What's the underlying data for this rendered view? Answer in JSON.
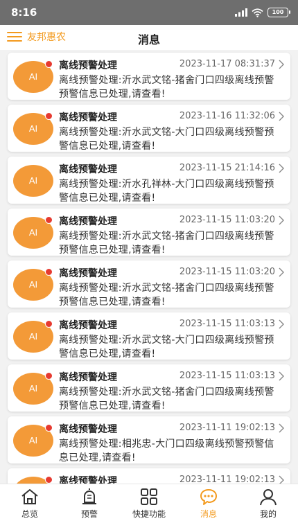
{
  "status_bar": {
    "time": "8:16",
    "battery": "100"
  },
  "header": {
    "brand": "友邦惠农",
    "title": "消息"
  },
  "messages": [
    {
      "avatar": "AI",
      "title": "离线预警处理",
      "time": "2023-11-17 08:31:37",
      "body": "离线预警处理:沂水武文铭-猪舍门口四级离线预警预警信息已处理,请查看!"
    },
    {
      "avatar": "AI",
      "title": "离线预警处理",
      "time": "2023-11-16 11:32:06",
      "body": "离线预警处理:沂水武文铭-大门口四级离线预警预警信息已处理,请查看!"
    },
    {
      "avatar": "AI",
      "title": "离线预警处理",
      "time": "2023-11-15 21:14:16",
      "body": "离线预警处理:沂水孔祥林-大门口四级离线预警预警信息已处理,请查看!"
    },
    {
      "avatar": "AI",
      "title": "离线预警处理",
      "time": "2023-11-15 11:03:20",
      "body": "离线预警处理:沂水武文铭-猪舍门口四级离线预警预警信息已处理,请查看!"
    },
    {
      "avatar": "AI",
      "title": "离线预警处理",
      "time": "2023-11-15 11:03:20",
      "body": "离线预警处理:沂水武文铭-猪舍门口四级离线预警预警信息已处理,请查看!"
    },
    {
      "avatar": "AI",
      "title": "离线预警处理",
      "time": "2023-11-15 11:03:13",
      "body": "离线预警处理:沂水武文铭-大门口四级离线预警预警信息已处理,请查看!"
    },
    {
      "avatar": "AI",
      "title": "离线预警处理",
      "time": "2023-11-15 11:03:13",
      "body": "离线预警处理:沂水武文铭-猪舍门口四级离线预警预警信息已处理,请查看!"
    },
    {
      "avatar": "AI",
      "title": "离线预警处理",
      "time": "2023-11-11 19:02:13",
      "body": "离线预警处理:相兆忠-大门口四级离线预警预警信息已处理,请查看!"
    },
    {
      "avatar": "",
      "title": "离线预警处理",
      "time": "2023-11-11 19:02:13",
      "body": ""
    }
  ],
  "tabs": [
    {
      "label": "总览",
      "icon": "home-icon",
      "active": false
    },
    {
      "label": "预警",
      "icon": "alarm-icon",
      "active": false
    },
    {
      "label": "快捷功能",
      "icon": "grid-icon",
      "active": false
    },
    {
      "label": "消息",
      "icon": "chat-icon",
      "active": true
    },
    {
      "label": "我的",
      "icon": "user-icon",
      "active": false
    }
  ],
  "colors": {
    "accent": "#f39a1e",
    "avatar": "#f39a38",
    "badge": "#e63a30",
    "status_bar": "#6e6e6e"
  }
}
